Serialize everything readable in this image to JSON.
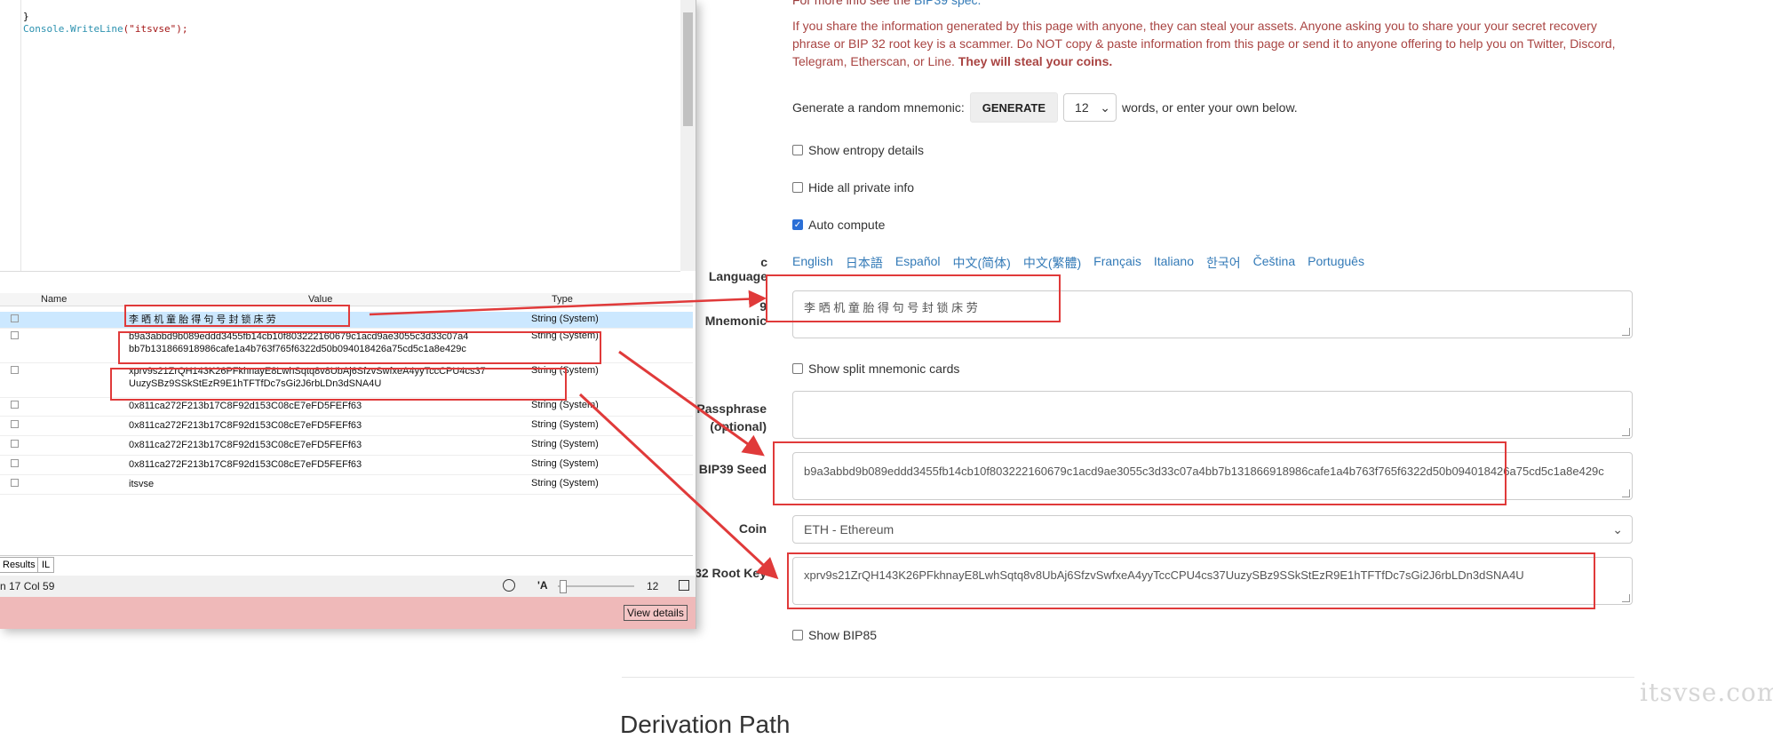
{
  "web": {
    "info_prefix": "For more info see the",
    "info_link": "BIP39 spec.",
    "warning": "If you share the information generated by this page with anyone, they can steal your assets. Anyone asking you to share your your secret recovery phrase or BIP 32 root key is a scammer. Do NOT copy & paste information from this page or send it to anyone offering to help you on Twitter, Discord, Telegram, Etherscan, or Line.",
    "warning_bold": "They will steal your coins.",
    "generate_prefix": "Generate a random mnemonic:",
    "generate_button": "GENERATE",
    "word_count": "12",
    "generate_suffix": "words, or enter your own below.",
    "show_entropy": "Show entropy details",
    "hide_private": "Hide all private info",
    "auto_compute": "Auto compute",
    "language_label": "c Language",
    "languages": [
      "English",
      "日本語",
      "Español",
      "中文(简体)",
      "中文(繁體)",
      "Français",
      "Italiano",
      "한국어",
      "Čeština",
      "Português"
    ],
    "mnemonic_label": "9 Mnemonic",
    "mnemonic_value": "李 晒 机 童 胎 得 句 号 封 锁 床 劳",
    "split_cards": "Show split mnemonic cards",
    "passphrase_label_1": "Passphrase",
    "passphrase_label_2": "(optional)",
    "passphrase_value": "",
    "seed_label": "BIP39 Seed",
    "seed_value": "b9a3abbd9b089eddd3455fb14cb10f803222160679c1acd9ae3055c3d33c07a4bb7b131866918986cafe1a4b763f765f6322d50b094018426a75cd5c1a8e429c",
    "coin_label": "Coin",
    "coin_value": "ETH - Ethereum",
    "root_key_label": "32 Root Key",
    "root_key_value": "xprv9s21ZrQH143K26PFkhnayE8LwhSqtq8v8UbAj6SfzvSwfxeA4yyTccCPU4cs37UuzySBz9SSkStEzR9E1hTFTfDc7sGi2J6rbLDn3dSNA4U",
    "show_bip85": "Show BIP85",
    "derivation_heading": "Derivation Path",
    "watermark": "itsvse.com"
  },
  "ide": {
    "code_line_1": "}",
    "code_line_2_method": "Console.WriteLine",
    "code_line_2_arg": "(\"itsvse\");",
    "columns": [
      "Name",
      "Value",
      "Type"
    ],
    "rows": [
      {
        "value": "李 晒 机 童 胎 得 句 号 封 锁 床 劳",
        "value2": "",
        "type": "String (System)"
      },
      {
        "value": "b9a3abbd9b089eddd3455fb14cb10f803222160679c1acd9ae3055c3d33c07a4",
        "value2": "bb7b131866918986cafe1a4b763f765f6322d50b094018426a75cd5c1a8e429c",
        "type": "String (System)"
      },
      {
        "value": "xprv9s21ZrQH143K26PFkhnayE8LwhSqtq8v8UbAj6SfzvSwfxeA4yyTccCPU4cs37",
        "value2": "UuzySBz9SSkStEzR9E1hTFTfDc7sGi2J6rbLDn3dSNA4U",
        "type": "String (System)"
      },
      {
        "value": "0x811ca272F213b17C8F92d153C08cE7eFD5FEFf63",
        "value2": "",
        "type": "String (System)"
      },
      {
        "value": "0x811ca272F213b17C8F92d153C08cE7eFD5FEFf63",
        "value2": "",
        "type": "String (System)"
      },
      {
        "value": "0x811ca272F213b17C8F92d153C08cE7eFD5FEFf63",
        "value2": "",
        "type": "String (System)"
      },
      {
        "value": "0x811ca272F213b17C8F92d153C08cE7eFD5FEFf63",
        "value2": "",
        "type": "String (System)"
      },
      {
        "value": "itsvse",
        "value2": "",
        "type": "String (System)"
      }
    ],
    "tab_results": "Results",
    "tab_il": "IL",
    "status_position": "n 17 Col 59",
    "zoom_glyph": "'A",
    "zoom_value": "12",
    "view_details": "View details"
  },
  "colors": {
    "annotation": "#e03a3a",
    "link": "#337ab7",
    "warning": "#a94442"
  }
}
